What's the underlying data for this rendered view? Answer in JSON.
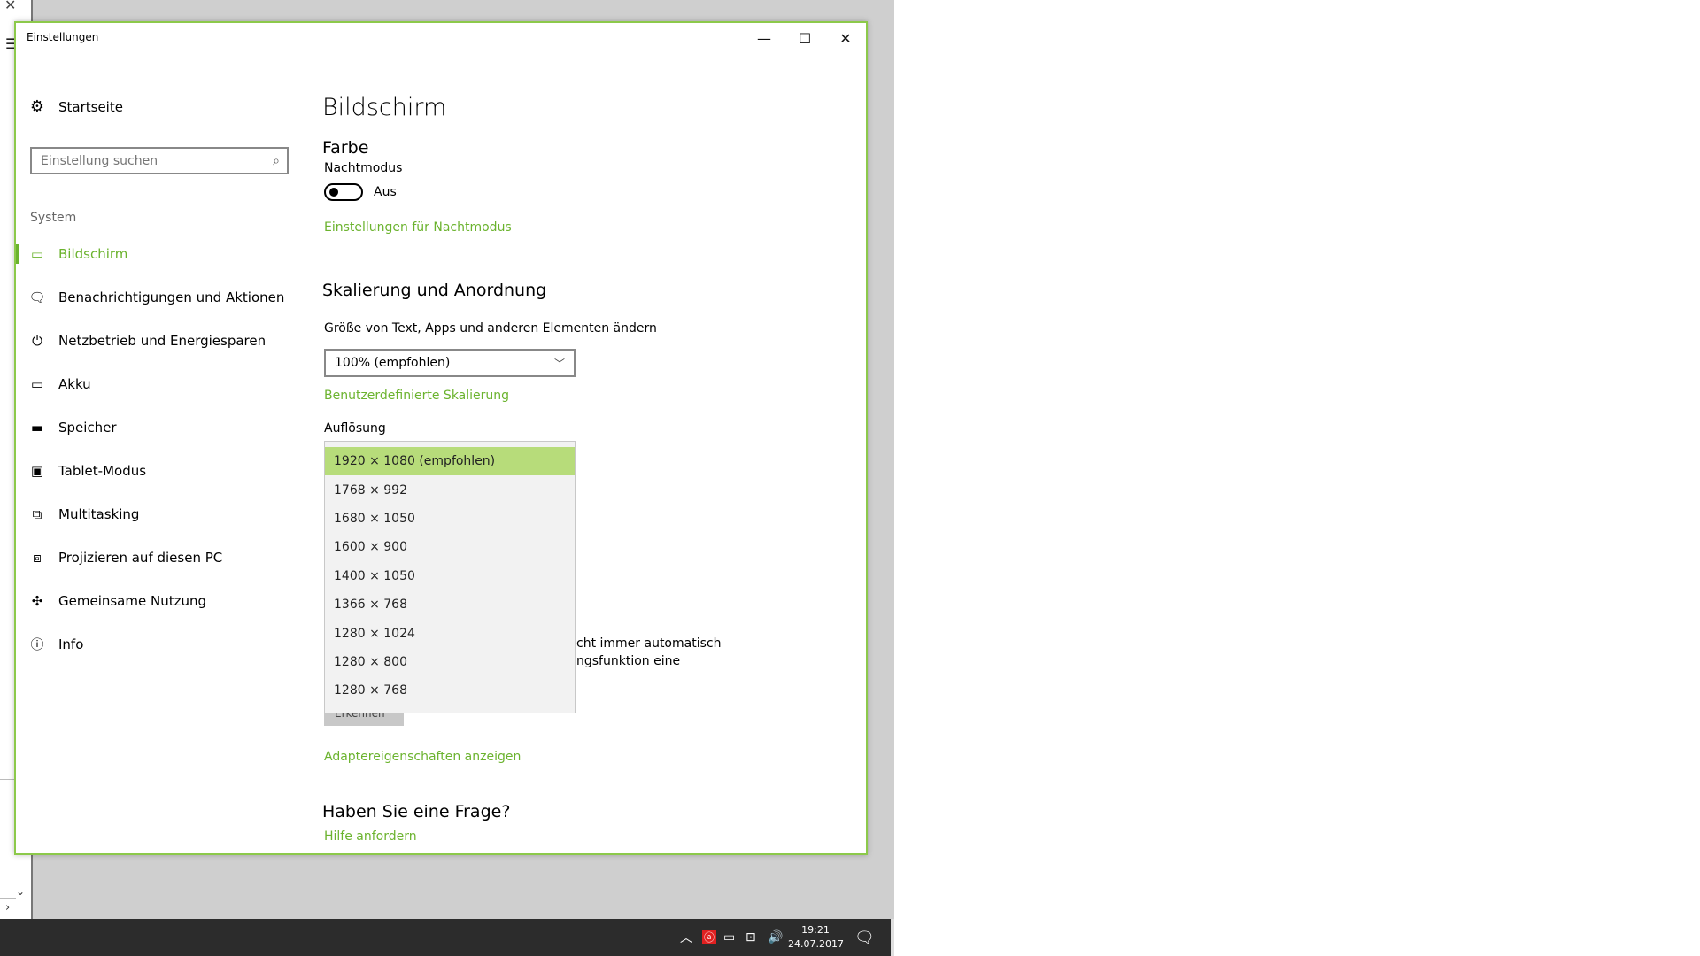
{
  "window": {
    "title": "Einstellungen",
    "minimize": "—",
    "maximize": "☐",
    "close": "✕"
  },
  "sidebar": {
    "home_label": "Startseite",
    "search_placeholder": "Einstellung suchen",
    "section_heading": "System",
    "items": [
      {
        "label": "Bildschirm",
        "icon": "monitor-icon",
        "active": true
      },
      {
        "label": "Benachrichtigungen und Aktionen",
        "icon": "notification-icon",
        "active": false
      },
      {
        "label": "Netzbetrieb und Energiesparen",
        "icon": "power-icon",
        "active": false
      },
      {
        "label": "Akku",
        "icon": "battery-icon",
        "active": false
      },
      {
        "label": "Speicher",
        "icon": "storage-icon",
        "active": false
      },
      {
        "label": "Tablet-Modus",
        "icon": "tablet-icon",
        "active": false
      },
      {
        "label": "Multitasking",
        "icon": "multitasking-icon",
        "active": false
      },
      {
        "label": "Projizieren auf diesen PC",
        "icon": "project-icon",
        "active": false
      },
      {
        "label": "Gemeinsame Nutzung",
        "icon": "share-icon",
        "active": false
      },
      {
        "label": "Info",
        "icon": "info-icon",
        "active": false
      }
    ]
  },
  "content": {
    "page_title": "Bildschirm",
    "color_heading": "Farbe",
    "night_mode_label": "Nachtmodus",
    "night_mode_state": "Aus",
    "night_mode_on": false,
    "night_mode_settings_link": "Einstellungen für Nachtmodus",
    "scale_heading": "Skalierung und Anordnung",
    "scale_label": "Größe von Text, Apps und anderen Elementen ändern",
    "scale_value": "100% (empfohlen)",
    "custom_scaling_link": "Benutzerdefinierte Skalierung",
    "resolution_label": "Auflösung",
    "resolution_options": [
      "1920 × 1080 (empfohlen)",
      "1768 × 992",
      "1680 × 1050",
      "1600 × 900",
      "1400 × 1050",
      "1366 × 768",
      "1280 × 1024",
      "1280 × 800",
      "1280 × 768"
    ],
    "resolution_selected_index": 0,
    "hidden_text_line1": "cht immer automatisch",
    "hidden_text_line2": "ngsfunktion eine",
    "hidden_button_label": "Erkennen",
    "adapter_link": "Adaptereigenschaften anzeigen",
    "question_heading": "Haben Sie eine Frage?",
    "help_link": "Hilfe anfordern"
  },
  "taskbar": {
    "time": "19:21",
    "date": "24.07.2017"
  },
  "colors": {
    "accent": "#6bb32e",
    "selected_item_bg": "#b7dc7a",
    "taskbar_bg": "#2c2c2c",
    "desktop_bg": "#cfcfcf"
  }
}
